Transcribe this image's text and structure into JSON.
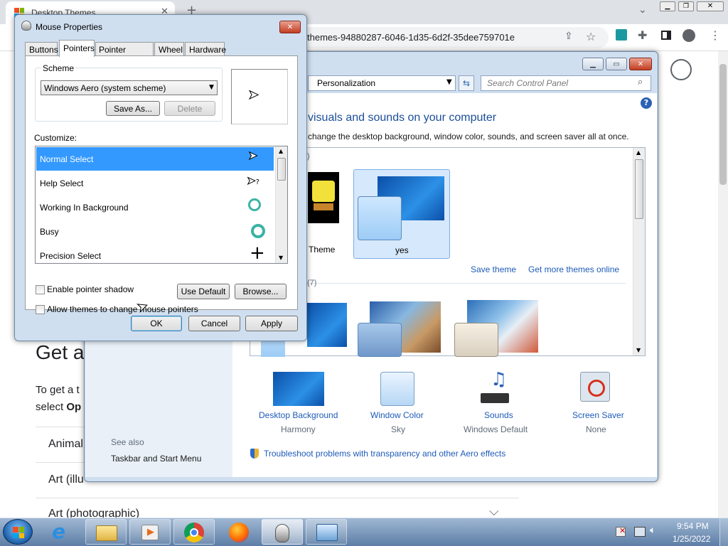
{
  "browser": {
    "tab_title": "Desktop Themes",
    "omnibox_text": "themes-94880287-6046-1d35-6d2f-35dee759701e",
    "page": {
      "heading_partial": "Get a",
      "para_line1": "To get a t",
      "para_line2_prefix": "select ",
      "para_line2_bold": "Op",
      "rows": [
        "Animal",
        "Art (illu",
        "Art (photographic)"
      ]
    }
  },
  "control_panel": {
    "breadcrumb": "Personalization",
    "search_placeholder": "Search Control Panel",
    "heading": "visuals and sounds on your computer",
    "subheading": "change the desktop background, window color, sounds, and screen saver all at once.",
    "section1_count": ")",
    "section2_count": "(7)",
    "theme1_label": "Theme",
    "theme2_label": "yes",
    "save_theme": "Save theme",
    "get_more_themes": "Get more themes online",
    "items": [
      {
        "label": "Desktop Background",
        "value": "Harmony"
      },
      {
        "label": "Window Color",
        "value": "Sky"
      },
      {
        "label": "Sounds",
        "value": "Windows Default"
      },
      {
        "label": "Screen Saver",
        "value": "None"
      }
    ],
    "see_also_label": "See also",
    "see_also_link": "Taskbar and Start Menu",
    "troubleshoot_link": "Troubleshoot problems with transparency and other Aero effects"
  },
  "mouse_props": {
    "title": "Mouse Properties",
    "tabs": [
      "Buttons",
      "Pointers",
      "Pointer Options",
      "Wheel",
      "Hardware"
    ],
    "active_tab": "Pointers",
    "scheme_label": "Scheme",
    "scheme_value": "Windows Aero (system scheme)",
    "save_as": "Save As...",
    "delete": "Delete",
    "customize_label": "Customize:",
    "pointer_list": [
      "Normal Select",
      "Help Select",
      "Working In Background",
      "Busy",
      "Precision Select"
    ],
    "selected_pointer": "Normal Select",
    "enable_shadow": "Enable pointer shadow",
    "use_default": "Use Default",
    "browse": "Browse...",
    "allow_themes": "Allow themes to change mouse pointers",
    "ok": "OK",
    "cancel": "Cancel",
    "apply": "Apply"
  },
  "taskbar": {
    "time": "9:54 PM",
    "date": "1/25/2022"
  },
  "colors": {
    "selection_blue": "#3399ff",
    "link_blue": "#1e5bb8",
    "taskbar_top": "#9fb7d3",
    "taskbar_bottom": "#5d7ea6"
  }
}
